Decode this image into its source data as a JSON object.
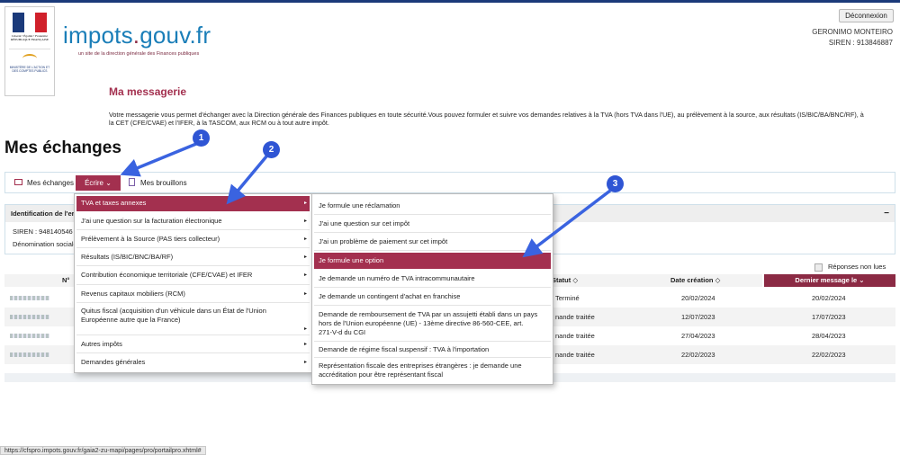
{
  "header": {
    "republic_text": "Liberté • Égalité • Fraternité RÉPUBLIQUE FRANÇAISE",
    "ministry_text": "MINISTÈRE DE L'ACTION ET DES COMPTES PUBLICS",
    "logo_main": "impots",
    "logo_dot": ".",
    "logo_tld": "gouv.fr",
    "tagline": "un site de la direction générale des Finances publiques",
    "logout_label": "Déconnexion",
    "user_name": "GERONIMO MONTEIRO",
    "user_siren": "SIREN : 913846887"
  },
  "page": {
    "title": "Ma messagerie",
    "intro": "Votre messagerie vous permet d'échanger avec la Direction générale des Finances publiques en toute sécurité.Vous pouvez formuler et suivre vos demandes relatives à la TVA (hors TVA dans l'UE), au prélèvement à la source, aux résultats (IS/BIC/BA/BNC/RF), à la CET (CFE/CVAE) et l'IFER, à la TASCOM, aux RCM ou à tout autre impôt.",
    "section_title": "Mes échanges"
  },
  "toolbar": {
    "exchanges_label": "Mes échanges",
    "write_label": "Écrire",
    "write_chevron": "⌄",
    "drafts_label": "Mes brouillons"
  },
  "ident": {
    "title": "Identification de l'er",
    "toggle": "−",
    "siren_line": "SIREN : 948140546",
    "denomination_line": "Dénomination sociale"
  },
  "unread_label": "Réponses non lues",
  "table": {
    "headers": {
      "num": "N°",
      "status": "Statut ◇",
      "created": "Date création ◇",
      "last_message": "Dernier message le ⌄"
    },
    "rows": [
      {
        "status": "Terminé",
        "created": "20/02/2024",
        "last": "20/02/2024"
      },
      {
        "status": "nande traitée",
        "created": "12/07/2023",
        "last": "17/07/2023"
      },
      {
        "status": "nande traitée",
        "created": "27/04/2023",
        "last": "28/04/2023"
      },
      {
        "status": "nande traitée",
        "created": "22/02/2023",
        "last": "22/02/2023"
      }
    ]
  },
  "menu_level1": {
    "items": [
      "TVA et taxes annexes",
      "J'ai une question sur la facturation électronique",
      "Prélèvement à la Source (PAS tiers collecteur)",
      "Résultats (IS/BIC/BNC/BA/RF)",
      "Contribution économique territoriale (CFE/CVAE) et IFER",
      "Revenus capitaux mobiliers (RCM)",
      "Quitus fiscal (acquisition d'un véhicule dans un État de l'Union Européenne autre que la France)",
      "Autres impôts",
      "Demandes générales"
    ],
    "chevron": "▸"
  },
  "menu_level2": {
    "items": [
      "Je formule une réclamation",
      "J'ai une question sur cet impôt",
      "J'ai un problème de paiement sur cet impôt",
      "Je formule une option",
      "Je demande un numéro de TVA intracommunautaire",
      "Je demande un contingent d'achat en franchise",
      "Demande de remboursement de TVA par un assujetti établi dans un pays hors de l'Union européenne (UE) - 13ème directive 86-560-CEE, art. 271-V-d du CGI",
      "Demande de régime fiscal suspensif : TVA à l'importation",
      "Représentation fiscale des entreprises étrangères : je demande une accréditation pour être représentant fiscal"
    ]
  },
  "annotations": {
    "badges": [
      "1",
      "2",
      "3"
    ],
    "arrow_color": "#3a63e0"
  },
  "statusbar": "https://cfspro.impots.gouv.fr/gaia2-zu-mapi/pages/pro/portailpro.xhtml#"
}
